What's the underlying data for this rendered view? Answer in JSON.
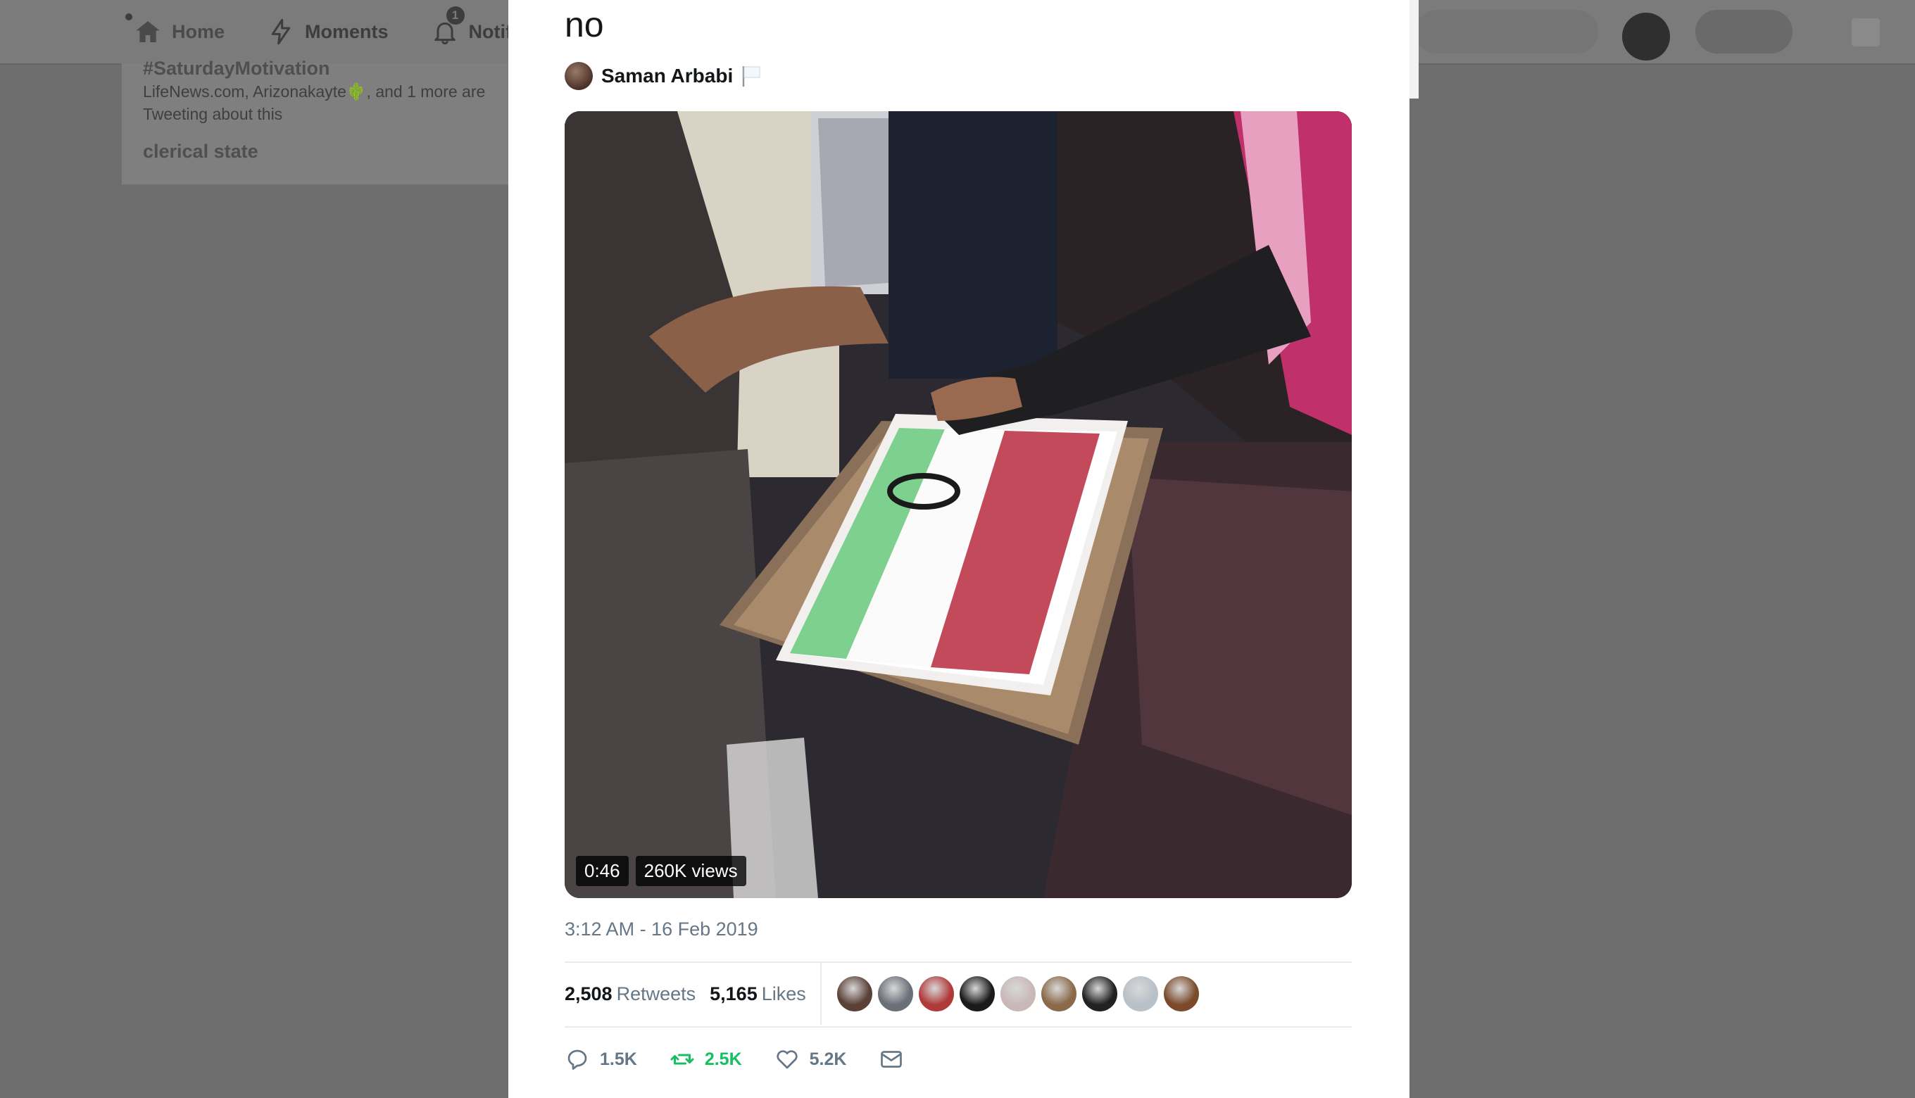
{
  "nav": {
    "home": "Home",
    "moments": "Moments",
    "notifications": "Notifi",
    "notifications_count": "1"
  },
  "trends": {
    "hashtag": "#SaturdayMotivation",
    "description": "LifeNews.com, Arizonakayte🌵, and 1 more are Tweeting about this",
    "next": "clerical state"
  },
  "tweet": {
    "text": "no",
    "quoted_author": "Saman Arbabi",
    "video": {
      "duration": "0:46",
      "views": "260K views"
    },
    "timestamp": "3:12 AM - 16 Feb 2019",
    "retweets_count": "2,508",
    "retweets_label": "Retweets",
    "likes_count": "5,165",
    "likes_label": "Likes",
    "liker_avatar_colors": [
      "#5a4036",
      "#6b6f78",
      "#b03a3a",
      "#1a1a1a",
      "#c9b8b8",
      "#8a6a4a",
      "#222222",
      "#b8c0c8",
      "#7a4a2a"
    ],
    "actions": {
      "reply": "1.5K",
      "retweet": "2.5K",
      "like": "5.2K"
    }
  },
  "colors": {
    "retweet_green": "#17bf63",
    "secondary_text": "#657786",
    "primary_text": "#14171a"
  }
}
